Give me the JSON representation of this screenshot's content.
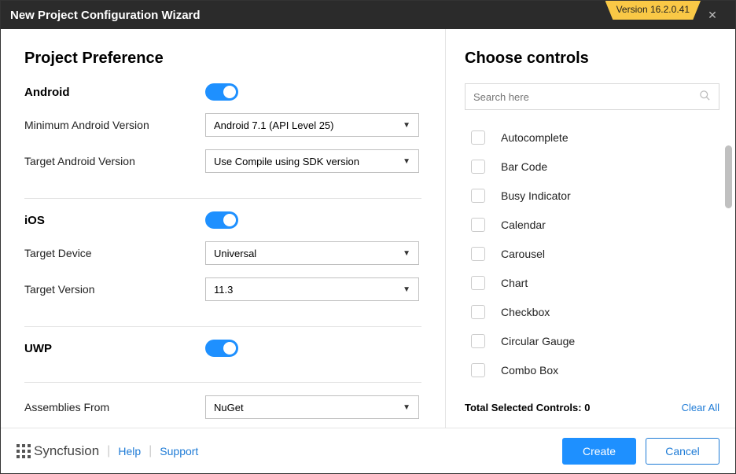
{
  "title": "New Project Configuration Wizard",
  "version_badge": "Version 16.2.0.41",
  "left": {
    "header": "Project Preference",
    "platforms": {
      "android": {
        "name": "Android",
        "rows": [
          {
            "label": "Minimum Android Version",
            "value": "Android 7.1 (API Level 25)"
          },
          {
            "label": "Target Android Version",
            "value": "Use Compile using SDK version"
          }
        ]
      },
      "ios": {
        "name": "iOS",
        "rows": [
          {
            "label": "Target Device",
            "value": "Universal"
          },
          {
            "label": "Target Version",
            "value": "11.3"
          }
        ]
      },
      "uwp": {
        "name": "UWP",
        "rows": []
      }
    },
    "assemblies_label": "Assemblies From",
    "assemblies_value": "NuGet"
  },
  "right": {
    "header": "Choose controls",
    "search_placeholder": "Search here",
    "controls": [
      "Autocomplete",
      "Bar Code",
      "Busy Indicator",
      "Calendar",
      "Carousel",
      "Chart",
      "Checkbox",
      "Circular Gauge",
      "Combo Box"
    ],
    "total_label": "Total Selected Controls:",
    "total_count": "0",
    "clear_all": "Clear All"
  },
  "footer": {
    "brand": "Syncfusion",
    "help": "Help",
    "support": "Support",
    "create": "Create",
    "cancel": "Cancel"
  }
}
